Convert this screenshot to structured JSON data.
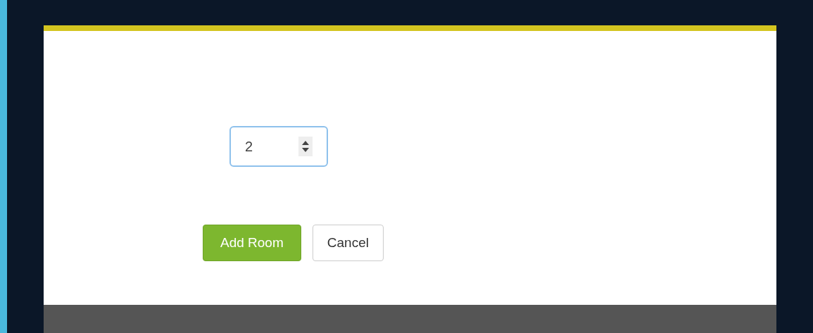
{
  "form": {
    "quantity_field": {
      "value": "2"
    }
  },
  "buttons": [
    {
      "label": "Add Room",
      "kind": "primary"
    },
    {
      "label": "Cancel",
      "kind": "secondary"
    }
  ]
}
